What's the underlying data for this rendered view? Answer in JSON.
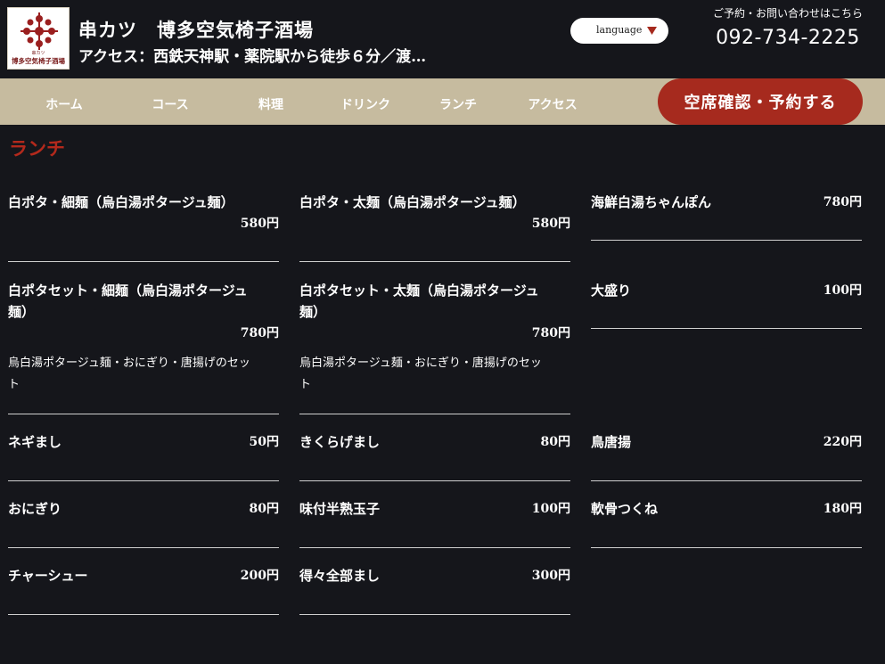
{
  "header": {
    "shop_name": "串カツ　博多空気椅子酒場",
    "access": "アクセス：西鉄天神駅・薬院駅から徒歩６分／渡…",
    "logo": {
      "line1": "串カツ",
      "line2": "博多空気椅子酒場"
    },
    "language_label": "language",
    "contact_label": "ご予約・お問い合わせはこちら",
    "phone": "092-734-2225"
  },
  "nav": {
    "items": [
      {
        "label": "ホーム"
      },
      {
        "label": "コース"
      },
      {
        "label": "料理"
      },
      {
        "label": "ドリンク"
      },
      {
        "label": "ランチ"
      },
      {
        "label": "アクセス"
      }
    ],
    "reserve_label": "空席確認・予約する"
  },
  "section": {
    "title": "ランチ"
  },
  "menu": {
    "col1": [
      {
        "name": "白ポタ・細麺（烏白湯ポタージュ麺）",
        "price": "580円"
      },
      {
        "name": "白ポタセット・細麺（烏白湯ポタージュ",
        "name2": "麺）",
        "price": "780円",
        "desc": "烏白湯ポタージュ麺・おにぎり・唐揚げのセッ",
        "desc2": "ト"
      },
      {
        "name": "ネギまし",
        "price": "50円"
      },
      {
        "name": "おにぎり",
        "price": "80円"
      },
      {
        "name": "チャーシュー",
        "price": "200円"
      }
    ],
    "col2": [
      {
        "name": "白ポタ・太麺（烏白湯ポタージュ麺）",
        "price": "580円"
      },
      {
        "name": "白ポタセット・太麺（烏白湯ポタージュ",
        "name2": "麺）",
        "price": "780円",
        "desc": "烏白湯ポタージュ麺・おにぎり・唐揚げのセッ",
        "desc2": "ト"
      },
      {
        "name": "きくらげまし",
        "price": "80円"
      },
      {
        "name": "味付半熟玉子",
        "price": "100円"
      },
      {
        "name": "得々全部まし",
        "price": "300円"
      }
    ],
    "col3": [
      {
        "name": "海鮮白湯ちゃんぽん",
        "price": "780円"
      },
      {
        "name": "大盛り",
        "price": "100円"
      },
      {
        "name": "鳥唐揚",
        "price": "220円"
      },
      {
        "name": "軟骨つくね",
        "price": "180円"
      }
    ]
  },
  "colors": {
    "background": "#15161b",
    "nav_background": "#c6bb9f",
    "accent_red": "#a62a1e",
    "title_red": "#b3291c"
  }
}
